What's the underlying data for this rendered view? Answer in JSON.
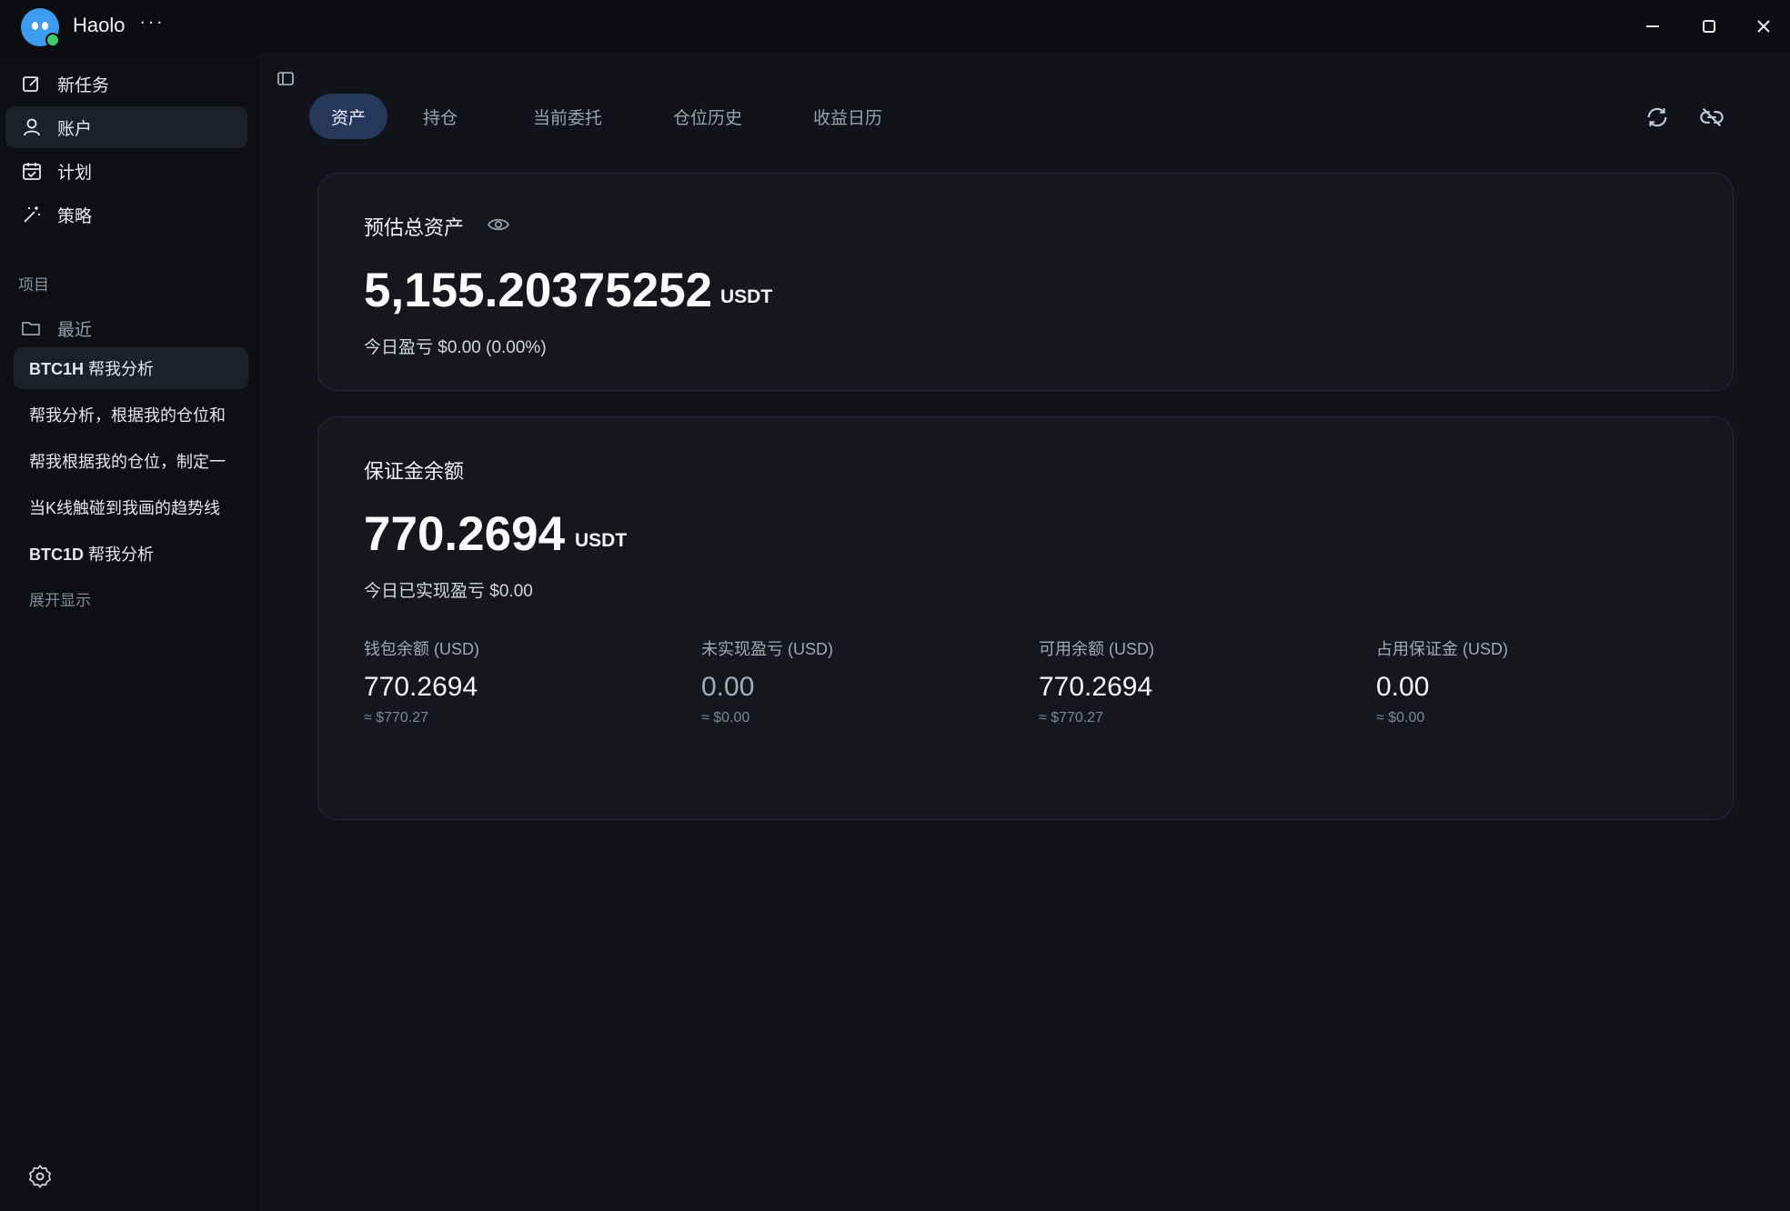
{
  "app": {
    "title": "Haolo",
    "more": "···"
  },
  "nav": [
    {
      "label": "新任务",
      "icon": "edit-icon"
    },
    {
      "label": "账户",
      "icon": "user-icon"
    },
    {
      "label": "计划",
      "icon": "calendar-icon"
    },
    {
      "label": "策略",
      "icon": "magic-wand-icon"
    }
  ],
  "projects": {
    "section_label": "项目",
    "recent_label": "最近",
    "tasks": [
      {
        "bold": "BTC1H",
        "text": " 帮我分析"
      },
      {
        "bold": "",
        "text": "帮我分析，根据我的仓位和"
      },
      {
        "bold": "",
        "text": "帮我根据我的仓位，制定一"
      },
      {
        "bold": "",
        "text": "当K线触碰到我画的趋势线"
      },
      {
        "bold": "BTC1D",
        "text": " 帮我分析"
      }
    ],
    "expand_label": "展开显示"
  },
  "tabs": [
    {
      "label": "资产"
    },
    {
      "label": "持仓"
    },
    {
      "label": "当前委托"
    },
    {
      "label": "仓位历史"
    },
    {
      "label": "收益日历"
    }
  ],
  "total_assets": {
    "title": "预估总资产",
    "value": "5,155.20375252",
    "unit": "USDT",
    "pnl_label": "今日盈亏",
    "pnl_value": "$0.00 (0.00%)"
  },
  "margin": {
    "title": "保证金余额",
    "value": "770.2694",
    "unit": "USDT",
    "realized_label": "今日已实现盈亏",
    "realized_value": "$0.00",
    "stats": [
      {
        "label": "钱包余额 (USD)",
        "value": "770.2694",
        "approx": "≈ $770.27"
      },
      {
        "label": "未实现盈亏 (USD)",
        "value": "0.00",
        "approx": "≈ $0.00"
      },
      {
        "label": "可用余额 (USD)",
        "value": "770.2694",
        "approx": "≈ $770.27"
      },
      {
        "label": "占用保证金 (USD)",
        "value": "0.00",
        "approx": "≈ $0.00"
      }
    ]
  },
  "colors": {
    "accent_tab": "#27395a",
    "status_online": "#3fcf6a",
    "logo": "#3b9cf0"
  }
}
